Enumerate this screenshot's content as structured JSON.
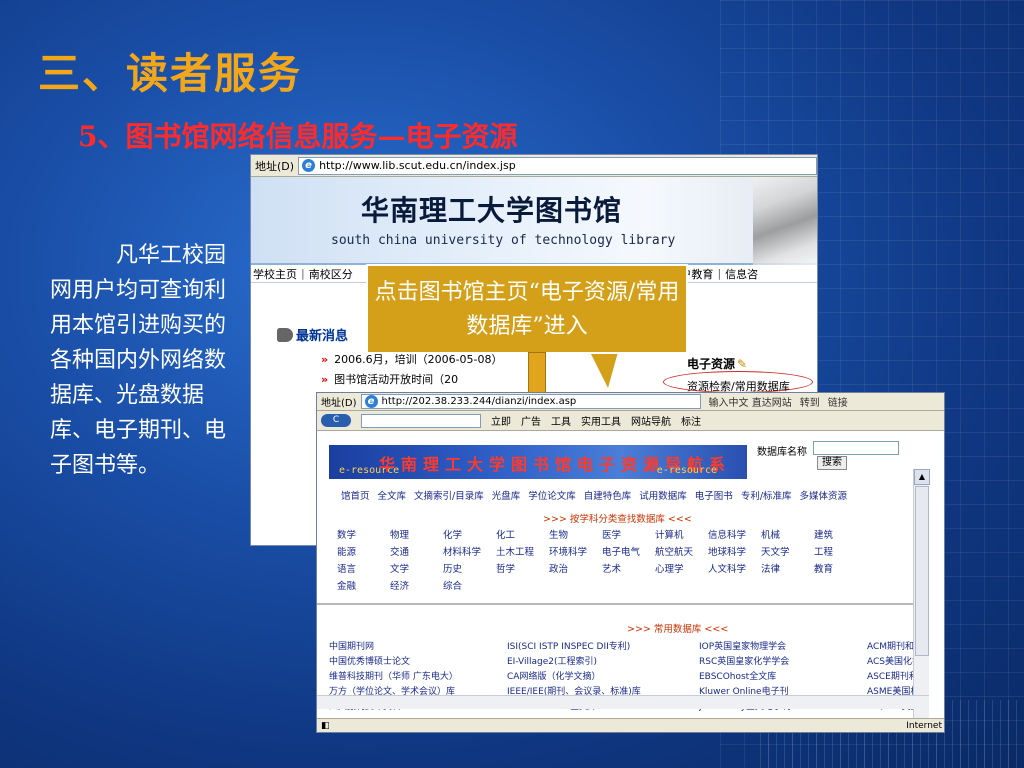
{
  "slide": {
    "title": "三、读者服务",
    "subtitle": "5、图书馆网络信息服务—电子资源",
    "body": "凡华工校园网用户均可查询利用本馆引进购买的各种国内外网络数据库、光盘数据库、电子期刊、电子图书等。",
    "callout": "点击图书馆主页“电子资源/常用数据库”进入"
  },
  "browser1": {
    "address_label": "地址(D)",
    "url": "http://www.lib.scut.edu.cn/index.jsp",
    "banner_title": "华南理工大学图书馆",
    "banner_en": "south china university of technology library",
    "nav": [
      "学校主页",
      "南校区分",
      "地",
      "用户教育",
      "信息咨"
    ],
    "news_header": "最新消息",
    "news_items": [
      "2006.6月，培训（2006-05-08）",
      "图书馆活动开放时间（20"
    ],
    "eres_title": "电子资源",
    "eres_link": "资源检索/常用数据库"
  },
  "browser2": {
    "address_label": "地址(D)",
    "url": "http://202.38.233.244/dianzi/index.asp",
    "addr_right": [
      "输入中文 直达网站",
      "转到",
      "链接"
    ],
    "toolbar": [
      "立即",
      "广告",
      "工具",
      "实用工具",
      "网站导航",
      "标注"
    ],
    "banner_title": "华南理工大学图书馆电子资源导航系统",
    "banner_eres": "e-resource",
    "dbname_label": "数据库名称",
    "search_btn": "搜索",
    "nav": [
      "馆首页",
      "全文库",
      "文摘索引/目录库",
      "光盘库",
      "学位论文库",
      "自建特色库",
      "试用数据库",
      "电子图书",
      "专利/标准库",
      "多媒体资源"
    ],
    "subject_header": ">>> 按学科分类查找数据库 <<<",
    "subjects": [
      "数学",
      "物理",
      "化学",
      "化工",
      "生物",
      "医学",
      "计算机",
      "信息科学",
      "机械",
      "建筑",
      "能源",
      "交通",
      "材料科学",
      "土木工程",
      "环境科学",
      "电子电气",
      "航空航天",
      "地球科学",
      "天文学",
      "工程",
      "语言",
      "文学",
      "历史",
      "哲学",
      "政治",
      "艺术",
      "心理学",
      "人文科学",
      "法律",
      "教育",
      "金融",
      "经济",
      "综合"
    ],
    "common_header": ">>> 常用数据库 <<<",
    "databases": [
      "中国期刊网",
      "ISI(SCI ISTP INSPEC DII专利)",
      "IOP英国皇家物理学会",
      "ACM期刊和会",
      "中国优秀博硕士论文",
      "EI-Village2(工程索引)",
      "RSC英国皇家化学学会",
      "ACS美国化学",
      "维普科技期刊（华师 广东电大）",
      "CA网络版（化学文摘）",
      "EBSCOhost全文库",
      "ASCE期刊和会",
      "万方（学位论文、学术会议）库",
      "IEEE/IEE(期刊、会议录、标准)库",
      "Kluwer Online电子刊",
      "ASME美国机械",
      "人大报刊复印资料",
      "Elsevier SDOL全文库",
      "John Wiley全文电子刊",
      "AIP/APS美国"
    ],
    "status_zone": "Internet"
  }
}
